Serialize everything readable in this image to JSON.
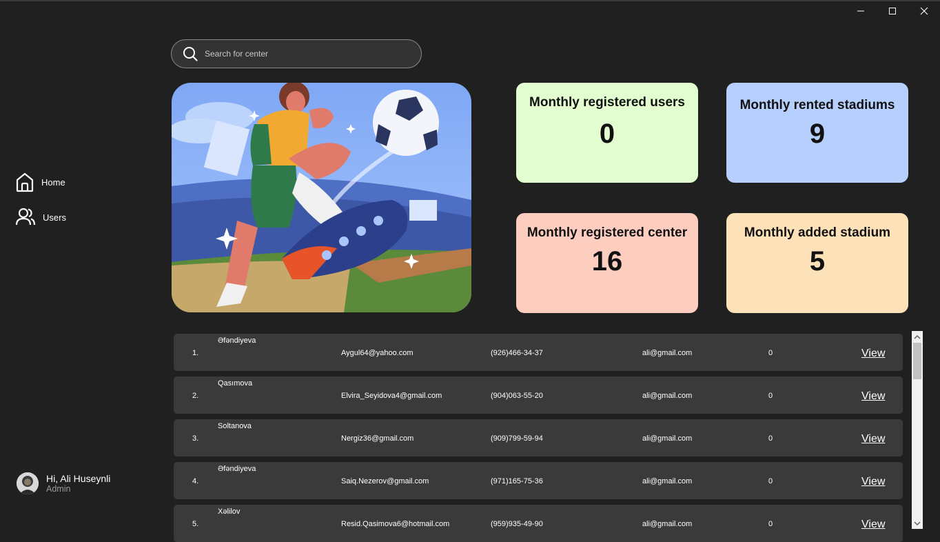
{
  "sidebar": {
    "items": [
      {
        "label": "Home",
        "icon": "home-icon"
      },
      {
        "label": "Users",
        "icon": "users-icon"
      }
    ],
    "user": {
      "greeting": "Hi, Ali Huseynli",
      "role": "Admin"
    }
  },
  "search": {
    "placeholder": "Search for center",
    "value": ""
  },
  "stats": [
    {
      "title": "Monthly registered users",
      "value": "0",
      "color": "#e2fdd0"
    },
    {
      "title": "Monthly rented stadiums",
      "value": "9",
      "color": "#b6cffd"
    },
    {
      "title": "Monthly registered center",
      "value": "16",
      "color": "#fdcdc0"
    },
    {
      "title": "Monthly added stadium",
      "value": "5",
      "color": "#fde1b8"
    }
  ],
  "table": {
    "view_label": "View",
    "rows": [
      {
        "num": "1.",
        "name": "Əfəndiyeva",
        "email": "Aygul64@yahoo.com",
        "phone": "(926)466-34-37",
        "contact": "ali@gmail.com",
        "count": "0"
      },
      {
        "num": "2.",
        "name": "Qasımova",
        "email": "Elvira_Seyidova4@gmail.com",
        "phone": "(904)063-55-20",
        "contact": "ali@gmail.com",
        "count": "0"
      },
      {
        "num": "3.",
        "name": "Soltanova",
        "email": "Nergiz36@gmail.com",
        "phone": "(909)799-59-94",
        "contact": "ali@gmail.com",
        "count": "0"
      },
      {
        "num": "4.",
        "name": "Əfəndiyeva",
        "email": "Saiq.Nezerov@gmail.com",
        "phone": "(971)165-75-36",
        "contact": "ali@gmail.com",
        "count": "0"
      },
      {
        "num": "5.",
        "name": "Xəlilov",
        "email": "Resid.Qasimova6@hotmail.com",
        "phone": "(959)935-49-90",
        "contact": "ali@gmail.com",
        "count": "0"
      }
    ]
  },
  "colors": {
    "background": "#202020",
    "row": "#3a3a3a"
  }
}
